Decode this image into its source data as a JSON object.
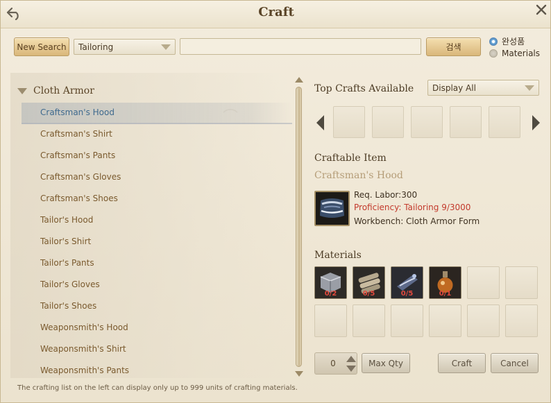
{
  "window": {
    "title": "Craft"
  },
  "search": {
    "new_search_label": "New Search",
    "category_value": "Tailoring",
    "query_value": "",
    "search_button_label": "검색",
    "radio_options": [
      {
        "label": "완성품",
        "selected": true
      },
      {
        "label": "Materials",
        "selected": false
      }
    ]
  },
  "left_list": {
    "category": "Cloth Armor",
    "items": [
      {
        "label": "Craftsman's Hood",
        "selected": true
      },
      {
        "label": "Craftsman's Shirt"
      },
      {
        "label": "Craftsman's Pants"
      },
      {
        "label": "Craftsman's Gloves"
      },
      {
        "label": "Craftsman's Shoes"
      },
      {
        "label": "Tailor's Hood"
      },
      {
        "label": "Tailor's Shirt"
      },
      {
        "label": "Tailor's Pants"
      },
      {
        "label": "Tailor's Gloves"
      },
      {
        "label": "Tailor's Shoes"
      },
      {
        "label": "Weaponsmith's Hood"
      },
      {
        "label": "Weaponsmith's Shirt"
      },
      {
        "label": "Weaponsmith's Pants"
      }
    ]
  },
  "top_crafts": {
    "label": "Top Crafts Available",
    "filter_value": "Display All",
    "slot_count": 5
  },
  "craftable": {
    "label": "Craftable Item",
    "item_name": "Craftsman's Hood",
    "req_labor": "Req. Labor:300",
    "proficiency": "Proficiency: Tailoring 9/3000",
    "workbench": "Workbench: Cloth Armor Form"
  },
  "materials": {
    "label": "Materials",
    "items": [
      {
        "icon": "fabric-bolt-icon",
        "count": "0/2"
      },
      {
        "icon": "leather-rolls-icon",
        "count": "0/5"
      },
      {
        "icon": "thread-spool-icon",
        "count": "0/5"
      },
      {
        "icon": "potion-flask-icon",
        "count": "0/1"
      }
    ]
  },
  "actions": {
    "quantity": "0",
    "max_qty_label": "Max Qty",
    "craft_label": "Craft",
    "cancel_label": "Cancel"
  },
  "footer": {
    "note": "The crafting list on the left can display only up to 999 units of crafting materials."
  },
  "colors": {
    "accent_button": "#d9b77a",
    "selected_text": "#3f6a8e",
    "warning_red": "#c33a2c"
  }
}
